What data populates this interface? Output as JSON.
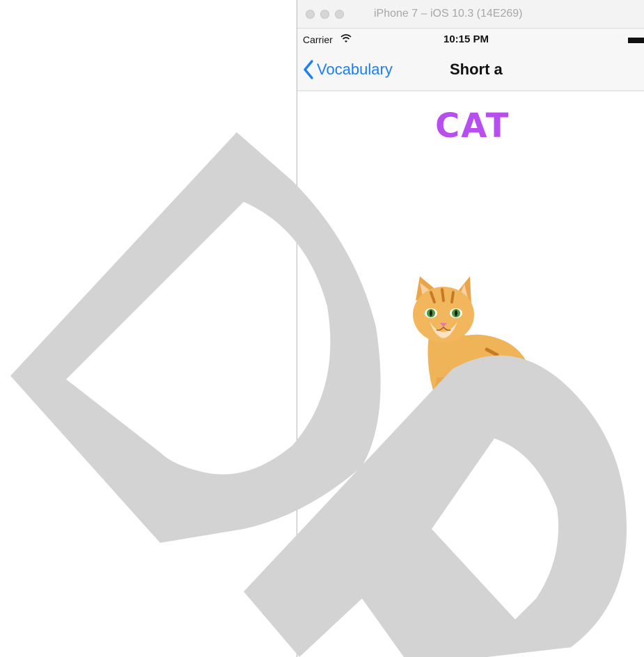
{
  "simulator": {
    "title": "iPhone 7 – iOS 10.3 (14E269)"
  },
  "status_bar": {
    "carrier": "Carrier",
    "time": "10:15 PM",
    "wifi_icon": "wifi-icon",
    "battery_icon": "battery-icon"
  },
  "navbar": {
    "back_label": "Vocabulary",
    "back_icon": "chevron-left-icon",
    "title": "Short a"
  },
  "content": {
    "word": "CAT",
    "image": "cat-image",
    "word_color": "#b74ef0"
  },
  "colors": {
    "ios_blue": "#1b7ff5",
    "watermark": "#d3d3d3"
  }
}
